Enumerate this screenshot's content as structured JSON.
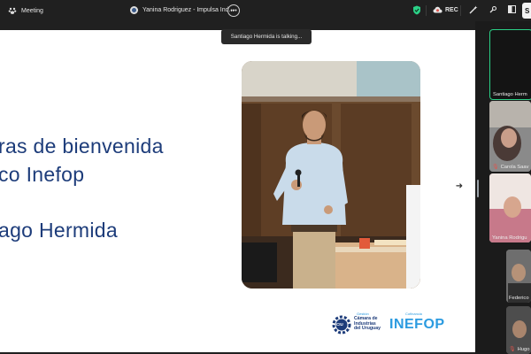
{
  "topbar": {
    "meeting_label": "Meeting",
    "tab_title": "Yanina Rodriguez - Impulsa Ind...",
    "rec_label": "REC",
    "cut_button": "S"
  },
  "tooltip": {
    "text": "Santiago Hermida is talking..."
  },
  "slide": {
    "line1": "ras de bienvenida",
    "line2": "co Inefop",
    "line3": "ago Hermida",
    "logo1": {
      "mark": "CIU",
      "small": "Gestión",
      "line1": "Cámara de",
      "line2": "Industrias",
      "line3": "del Uruguay"
    },
    "logo2": {
      "small": "Cofinancia",
      "brand": "INEFOP"
    },
    "next_arrow": "➜"
  },
  "participants": [
    {
      "name": "Santiago Herm",
      "muted": false,
      "color": "#1a1a1a"
    },
    {
      "name": "Carola Saav",
      "muted": true,
      "color": "#6f6f6f"
    },
    {
      "name": "Yanina Rodrigu",
      "muted": false,
      "color": "#d49aa3"
    },
    {
      "name": "Federico",
      "muted": false,
      "color": "#8f8f8f"
    },
    {
      "name": "Hugo",
      "muted": true,
      "color": "#5a5a5a"
    }
  ],
  "colors": {
    "accent_green": "#2bd187",
    "slide_text": "#1d3c7a",
    "inefop_blue": "#2b9be0"
  }
}
